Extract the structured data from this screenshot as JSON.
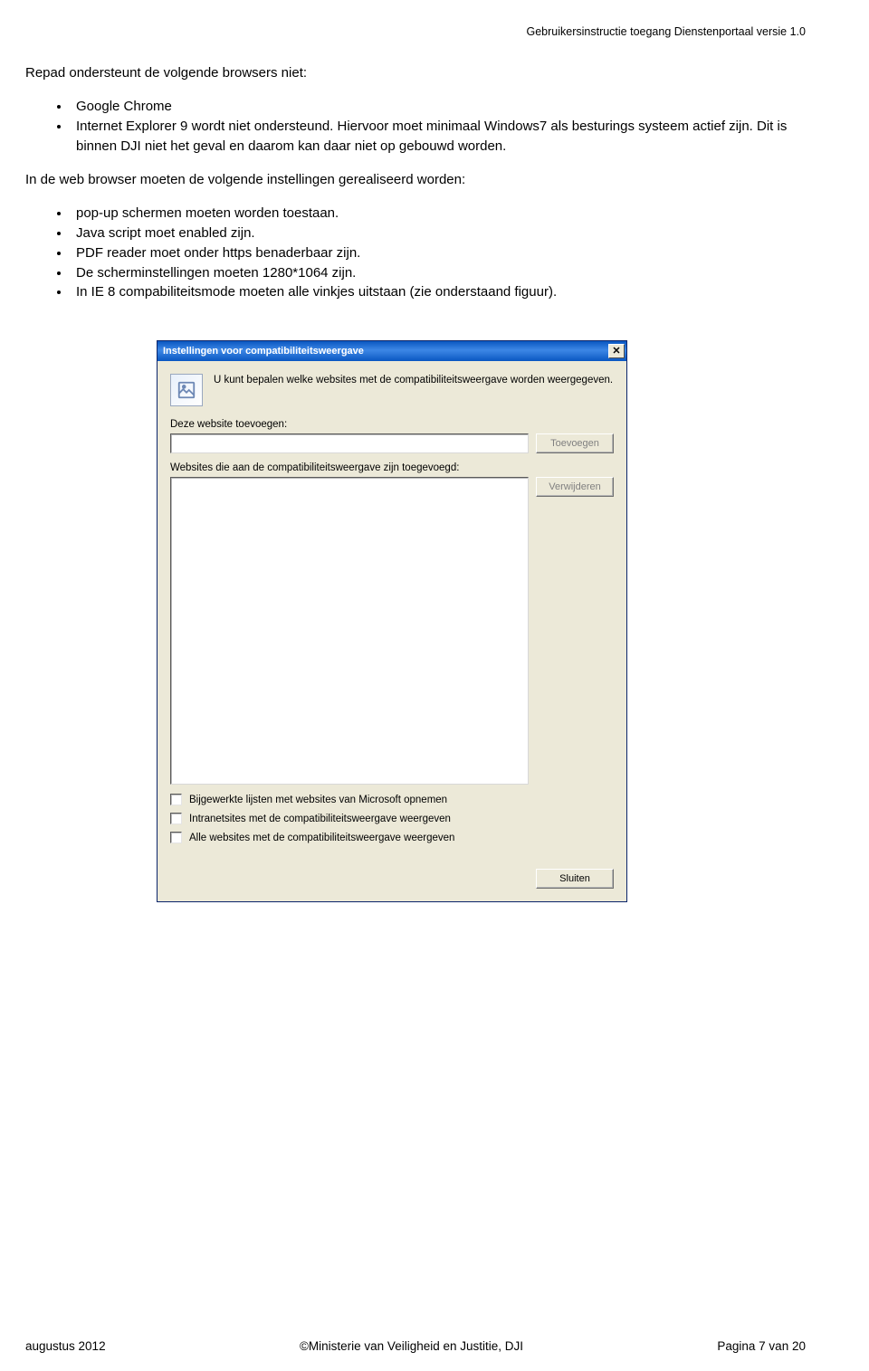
{
  "header": {
    "doc_title": "Gebruikersinstructie toegang Dienstenportaal versie 1.0"
  },
  "body": {
    "intro": "Repad ondersteunt de volgende browsers niet:",
    "list1": [
      "Google Chrome",
      "Internet Explorer 9 wordt niet ondersteund. Hiervoor moet minimaal Windows7 als besturings systeem actief zijn. Dit is binnen DJI niet het geval en daarom kan daar niet op gebouwd worden."
    ],
    "mid": "In de web browser moeten de volgende instellingen gerealiseerd worden:",
    "list2": [
      "pop-up schermen moeten worden toestaan.",
      "Java script moet enabled zijn.",
      "PDF reader moet onder https benaderbaar zijn.",
      "De scherminstellingen moeten 1280*1064 zijn.",
      "In IE 8 compabiliteitsmode moeten alle vinkjes uitstaan (zie onderstaand figuur)."
    ]
  },
  "dialog": {
    "title": "Instellingen voor compatibiliteitsweergave",
    "desc": "U kunt bepalen welke websites met de compatibiliteitsweergave worden weergegeven.",
    "label_add": "Deze website toevoegen:",
    "btn_add": "Toevoegen",
    "label_list": "Websites die aan de compatibiliteitsweergave zijn toegevoegd:",
    "btn_remove": "Verwijderen",
    "chk1": "Bijgewerkte lijsten met websites van Microsoft opnemen",
    "chk2": "Intranetsites met de compatibiliteitsweergave weergeven",
    "chk3": "Alle websites met de compatibiliteitsweergave weergeven",
    "btn_close": "Sluiten"
  },
  "footer": {
    "left": "augustus 2012",
    "center": "©Ministerie van Veiligheid en Justitie, DJI",
    "right": "Pagina 7 van 20"
  }
}
